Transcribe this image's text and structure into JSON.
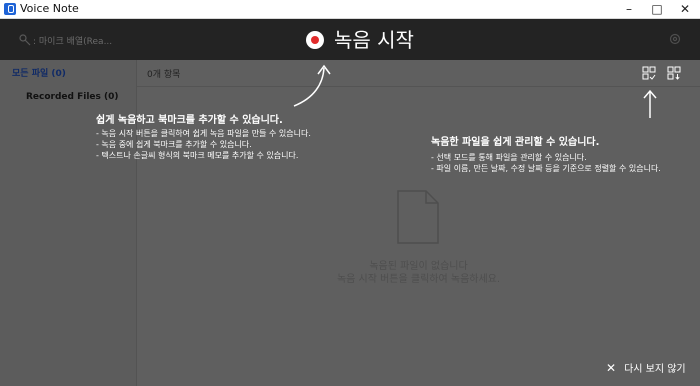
{
  "window": {
    "title": "Voice Note"
  },
  "toolbar": {
    "mic_device": ": 마이크 배열(Rea...",
    "record_label": "녹음 시작"
  },
  "sidebar": {
    "all_files": "모든 파일 (0)",
    "recorded_files": "Recorded Files (0)"
  },
  "list": {
    "count": "0개 항목"
  },
  "tips": {
    "record_title": "쉽게 녹음하고 북마크를 추가할 수 있습니다.",
    "record_lines": [
      "- 녹음 시작 버튼을 클릭하여 쉽게 녹음 파일을 만들 수 있습니다.",
      "- 녹음 중에 쉽게 북마크를 추가할 수 있습니다.",
      "- 텍스트나 손글씨 형식의 북마크 메모를 추가할 수 있습니다."
    ],
    "manage_title": "녹음한 파일을 쉽게 관리할 수 있습니다.",
    "manage_lines": [
      "- 선택 모드를 통해 파일을 관리할 수 있습니다.",
      "- 파일 이름, 만든 날짜, 수정 날짜 등을 기준으로 정렬할 수 있습니다."
    ]
  },
  "empty_state": {
    "line1": "녹음된 파일이 없습니다",
    "line2": "녹음 시작 버튼을 클릭하여 녹음하세요."
  },
  "dismiss": {
    "label": "다시 보지 않기"
  },
  "icons": {
    "app": "voice-note-app-icon",
    "mic": "microphone-icon",
    "record": "record-icon",
    "settings": "gear-icon",
    "select": "select-mode-icon",
    "sort": "sort-icon",
    "document": "document-icon",
    "close": "close-icon"
  },
  "colors": {
    "accent_record": "#e12b2b",
    "toolbar_bg": "#232323",
    "overlay_bg": "#5f5f5f"
  }
}
